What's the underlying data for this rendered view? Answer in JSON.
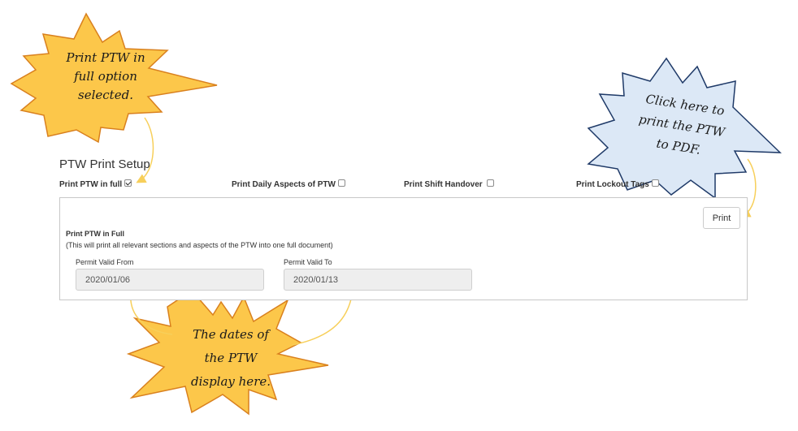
{
  "setup": {
    "title": "PTW Print Setup",
    "options": [
      {
        "label": "Print PTW in full",
        "checked": true
      },
      {
        "label": "Print Daily Aspects of PTW",
        "checked": false
      },
      {
        "label": "Print Shift Handover",
        "checked": false
      },
      {
        "label": "Print Lockout Tags",
        "checked": false
      }
    ]
  },
  "panel": {
    "print_label": "Print",
    "section_title": "Print PTW in Full",
    "section_desc": "(This will print all relevant sections and aspects of the PTW into one full document)",
    "valid_from_label": "Permit Valid From",
    "valid_from_value": "2020/01/06",
    "valid_to_label": "Permit Valid To",
    "valid_to_value": "2020/01/13"
  },
  "callouts": {
    "full_option": [
      "Print PTW in",
      "full option",
      "selected."
    ],
    "print_pdf": [
      "Click here to",
      "print the PTW",
      "to PDF."
    ],
    "dates": [
      "The dates of",
      "the PTW",
      "display here."
    ]
  },
  "colors": {
    "star_yellow": "#fcc74a",
    "star_yellow_border": "#d9801e",
    "star_blue": "#dce8f6",
    "star_blue_border": "#1f3a68",
    "arrow": "#f7cf5a"
  }
}
